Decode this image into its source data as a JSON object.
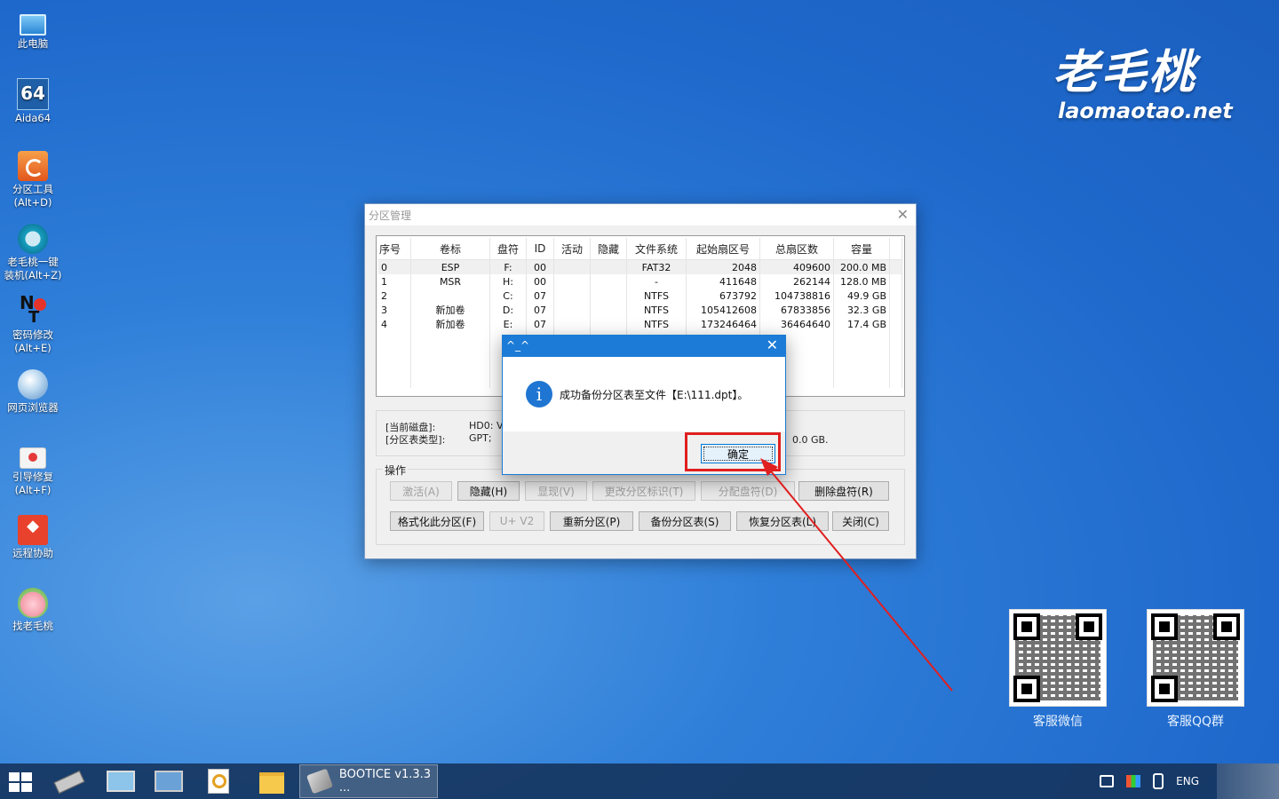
{
  "desktop": {
    "icons": [
      {
        "label": "此电脑",
        "icon": "computer-icon"
      },
      {
        "label": "Aida64",
        "icon": "aida64-icon",
        "glyph": "64"
      },
      {
        "label": "分区工具\n(Alt+D)",
        "line1": "分区工具",
        "line2": "(Alt+D)",
        "icon": "partition-tool-icon"
      },
      {
        "line1": "老毛桃一键",
        "line2": "装机(Alt+Z)",
        "icon": "one-click-install-icon"
      },
      {
        "line1": "密码修改",
        "line2": "(Alt+E)",
        "icon": "password-change-icon",
        "glyph_n": "N",
        "glyph_t": "T"
      },
      {
        "line1": "网页浏览器",
        "icon": "web-browser-icon"
      },
      {
        "line1": "引导修复",
        "line2": "(Alt+F)",
        "icon": "boot-repair-icon"
      },
      {
        "line1": "远程协助",
        "icon": "remote-assist-icon"
      },
      {
        "line1": "找老毛桃",
        "icon": "laomaotao-peach-icon"
      }
    ]
  },
  "logo": {
    "cn": "老毛桃",
    "en": "laomaotao.net"
  },
  "qr_codes": [
    {
      "label": "客服微信"
    },
    {
      "label": "客服QQ群"
    }
  ],
  "main_window": {
    "title": "分区管理",
    "close_glyph": "✕",
    "columns": [
      "序号",
      "卷标",
      "盘符",
      "ID",
      "活动",
      "隐藏",
      "文件系统",
      "起始扇区号",
      "总扇区数",
      "容量"
    ],
    "rows": [
      [
        "0",
        "ESP",
        "F:",
        "00",
        "",
        "",
        "FAT32",
        "2048",
        "409600",
        "200.0 MB"
      ],
      [
        "1",
        "MSR",
        "H:",
        "00",
        "",
        "",
        "-",
        "411648",
        "262144",
        "128.0 MB"
      ],
      [
        "2",
        "",
        "C:",
        "07",
        "",
        "",
        "NTFS",
        "673792",
        "104738816",
        "49.9 GB"
      ],
      [
        "3",
        "新加卷",
        "D:",
        "07",
        "",
        "",
        "NTFS",
        "105412608",
        "67833856",
        "32.3 GB"
      ],
      [
        "4",
        "新加卷",
        "E:",
        "07",
        "",
        "",
        "NTFS",
        "173246464",
        "36464640",
        "17.4 GB"
      ]
    ],
    "info": {
      "current_disk_key": "[当前磁盘]:",
      "current_disk_val": "HD0: VMw",
      "table_type_key": "[分区表类型]:",
      "table_type_val": "GPT;",
      "tail": "0.0 GB."
    },
    "ops_label": "操作",
    "buttons_row1": [
      {
        "label": "激活(A)",
        "enabled": false
      },
      {
        "label": "隐藏(H)",
        "enabled": true
      },
      {
        "label": "显现(V)",
        "enabled": false
      },
      {
        "label": "更改分区标识(T)",
        "enabled": false
      },
      {
        "label": "分配盘符(D)",
        "enabled": false
      },
      {
        "label": "删除盘符(R)",
        "enabled": true
      }
    ],
    "buttons_row2": [
      {
        "label": "格式化此分区(F)",
        "enabled": true
      },
      {
        "label": "U+ V2",
        "enabled": false
      },
      {
        "label": "重新分区(P)",
        "enabled": true
      },
      {
        "label": "备份分区表(S)",
        "enabled": true
      },
      {
        "label": "恢复分区表(L)",
        "enabled": true
      },
      {
        "label": "关闭(C)",
        "enabled": true
      }
    ]
  },
  "dialog": {
    "title": "^_^",
    "close_glyph": "✕",
    "icon_glyph": "i",
    "message": "成功备份分区表至文件【E:\\111.dpt】。",
    "ok_label": "确定"
  },
  "taskbar": {
    "active_app": "BOOTICE v1.3.3 ...",
    "language": "ENG"
  },
  "colors": {
    "desktop": "#2f7fd9",
    "dialog_title": "#1c7bd6",
    "highlight": "#e01f1f"
  }
}
